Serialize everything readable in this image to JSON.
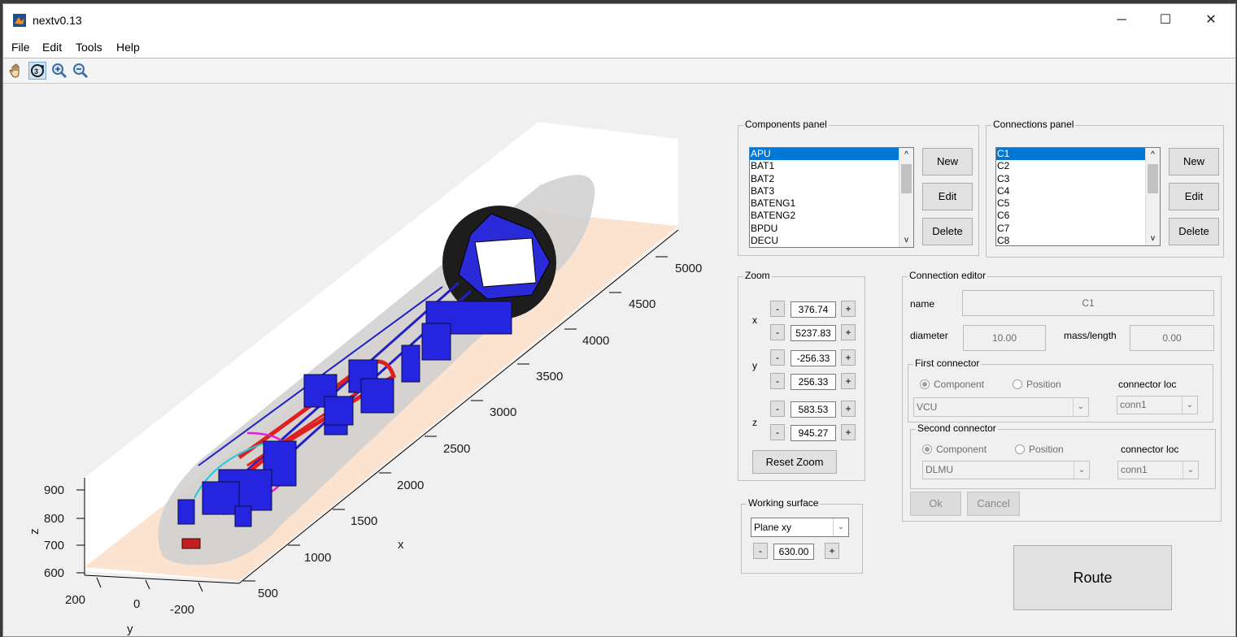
{
  "window": {
    "title": "nextv0.13",
    "minimize": "─",
    "maximize": "☐",
    "close": "✕"
  },
  "menu": {
    "file": "File",
    "edit": "Edit",
    "tools": "Tools",
    "help": "Help"
  },
  "plot": {
    "x_label": "x",
    "y_label": "y",
    "z_label": "z",
    "x_ticks": [
      "500",
      "1000",
      "1500",
      "2000",
      "2500",
      "3000",
      "3500",
      "4000",
      "4500",
      "5000"
    ],
    "y_ticks": [
      "200",
      "0",
      "-200"
    ],
    "z_ticks": [
      "900",
      "800",
      "700",
      "600"
    ]
  },
  "components_panel": {
    "title": "Components panel",
    "items": [
      "APU",
      "BAT1",
      "BAT2",
      "BAT3",
      "BATENG1",
      "BATENG2",
      "BPDU",
      "DECU"
    ],
    "selected": "APU",
    "new_label": "New",
    "edit_label": "Edit",
    "delete_label": "Delete"
  },
  "connections_panel": {
    "title": "Connections panel",
    "items": [
      "C1",
      "C2",
      "C3",
      "C4",
      "C5",
      "C6",
      "C7",
      "C8"
    ],
    "selected": "C1",
    "new_label": "New",
    "edit_label": "Edit",
    "delete_label": "Delete"
  },
  "zoom": {
    "title": "Zoom",
    "x_label": "x",
    "y_label": "y",
    "z_label": "z",
    "x_min": "376.74",
    "x_max": "5237.83",
    "y_min": "-256.33",
    "y_max": "256.33",
    "z_min": "583.53",
    "z_max": "945.27",
    "minus": "-",
    "plus": "+",
    "reset_label": "Reset Zoom"
  },
  "working_surface": {
    "title": "Working surface",
    "plane": "Plane xy",
    "value": "630.00",
    "minus": "-",
    "plus": "+"
  },
  "connection_editor": {
    "title": "Connection editor",
    "name_label": "name",
    "name_value": "C1",
    "diameter_label": "diameter",
    "diameter_value": "10.00",
    "mass_label": "mass/length",
    "mass_value": "0.00",
    "first": {
      "title": "First connector",
      "component": "Component",
      "position": "Position",
      "loc_label": "connector loc",
      "component_value": "VCU",
      "loc_value": "conn1"
    },
    "second": {
      "title": "Second connector",
      "component": "Component",
      "position": "Position",
      "loc_label": "connector loc",
      "component_value": "DLMU",
      "loc_value": "conn1"
    },
    "ok_label": "Ok",
    "cancel_label": "Cancel"
  },
  "route_label": "Route"
}
